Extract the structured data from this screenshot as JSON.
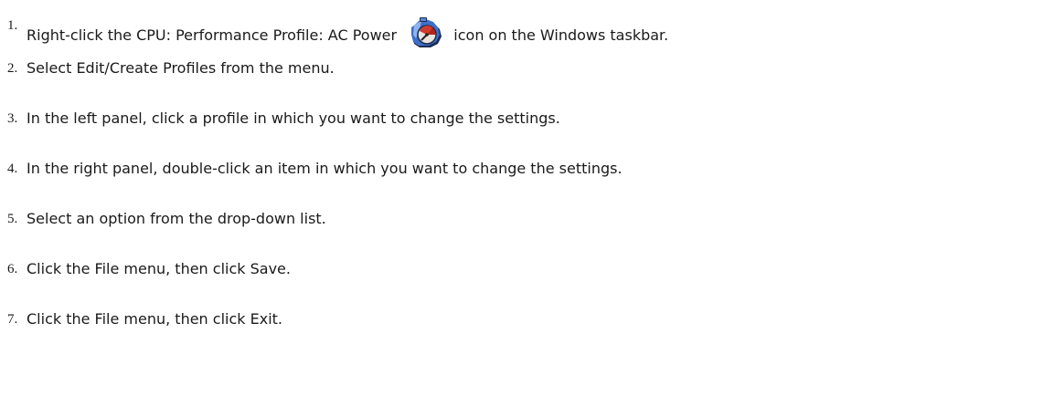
{
  "steps": [
    {
      "number": "1.",
      "before_icon": "Right-click the CPU: Performance Profile: AC Power",
      "icon": "cpu-performance-profile-icon",
      "after_icon": "icon on the Windows taskbar."
    },
    {
      "number": "2.",
      "text": "Select Edit/Create Profiles from the menu."
    },
    {
      "number": "3.",
      "text": "In the left panel, click a profile in which you want to change the settings."
    },
    {
      "number": "4.",
      "text": "In the right panel, double-click an item in which you want to change the settings."
    },
    {
      "number": "5.",
      "text": "Select an option from the drop-down list."
    },
    {
      "number": "6.",
      "text": "Click the File menu, then click Save."
    },
    {
      "number": "7.",
      "text": "Click the File menu, then click Exit."
    }
  ]
}
